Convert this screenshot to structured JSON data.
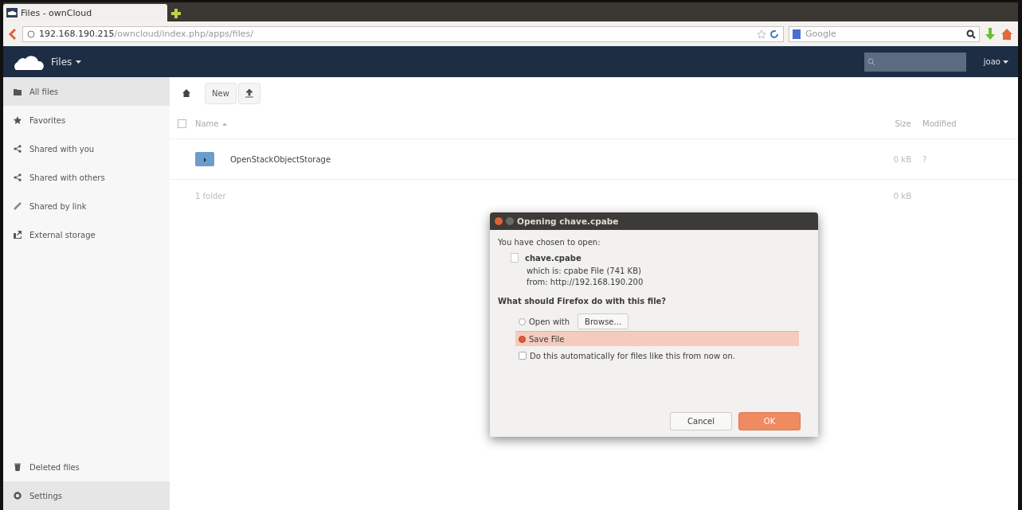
{
  "browser": {
    "tab_title": "Files - ownCloud",
    "url_host": "192.168.190.215",
    "url_path": "/owncloud/index.php/apps/files/",
    "search_placeholder": "Google"
  },
  "header": {
    "app_name": "Files",
    "user": "joao"
  },
  "sidebar": {
    "items": [
      {
        "label": "All files",
        "selected": true
      },
      {
        "label": "Favorites",
        "selected": false
      },
      {
        "label": "Shared with you",
        "selected": false
      },
      {
        "label": "Shared with others",
        "selected": false
      },
      {
        "label": "Shared by link",
        "selected": false
      },
      {
        "label": "External storage",
        "selected": false
      }
    ],
    "bottom_items": [
      {
        "label": "Deleted files",
        "selected": false
      },
      {
        "label": "Settings",
        "selected": true
      }
    ]
  },
  "files": {
    "new_button": "New",
    "select_all_checked": false,
    "columns": [
      "Name",
      "Size",
      "Modified"
    ],
    "rows": [
      {
        "name": "OpenStackObjectStorage",
        "size": "0 kB",
        "modified": "?"
      }
    ],
    "summary": {
      "text": "1 folder",
      "size": "0 kB"
    }
  },
  "dialog": {
    "title": "Opening chave.cpabe",
    "intro": "You have chosen to open:",
    "file_name": "chave.cpabe",
    "file_type": "which is: cpabe File (741 KB)",
    "file_from": "from: http://192.168.190.200",
    "question": "What should Firefox do with this file?",
    "options": [
      {
        "label": "Open with",
        "selected": false,
        "kind": "open"
      },
      {
        "label": "Save File",
        "selected": true,
        "kind": "save"
      }
    ],
    "browse_button": "Browse...",
    "remember": {
      "label": "Do this automatically for files like this from now on.",
      "checked": false
    },
    "buttons": [
      "Cancel",
      "OK"
    ]
  }
}
